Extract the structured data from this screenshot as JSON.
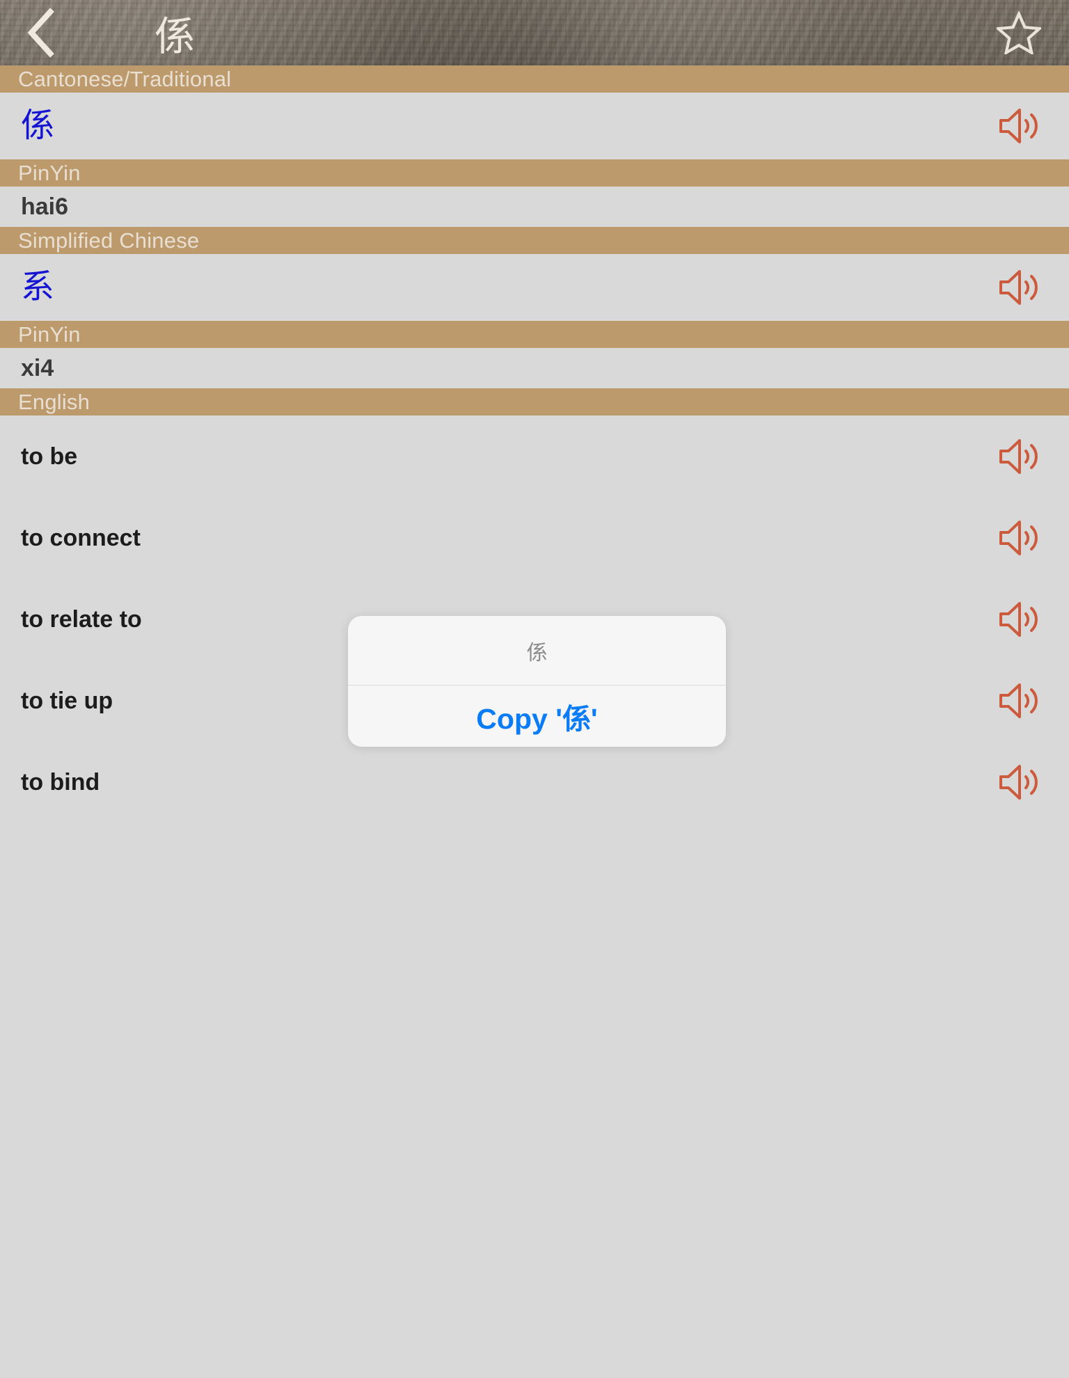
{
  "navbar": {
    "back_icon": "chevron-left-icon",
    "title": "係",
    "favorite_icon": "star-outline-icon"
  },
  "sections": [
    {
      "header": "Cantonese/Traditional",
      "type": "cjk",
      "rows": [
        {
          "text": "係",
          "has_audio": true,
          "audio_icon": "speaker-icon"
        }
      ]
    },
    {
      "header": "PinYin",
      "type": "pinyin",
      "rows": [
        {
          "text": "hai6",
          "has_audio": false
        }
      ]
    },
    {
      "header": "Simplified Chinese",
      "type": "cjk",
      "rows": [
        {
          "text": "系",
          "has_audio": true,
          "audio_icon": "speaker-icon"
        }
      ]
    },
    {
      "header": "PinYin",
      "type": "pinyin",
      "rows": [
        {
          "text": "xi4",
          "has_audio": false
        }
      ]
    },
    {
      "header": "English",
      "type": "english",
      "rows": [
        {
          "text": "to be",
          "has_audio": true,
          "audio_icon": "speaker-icon"
        },
        {
          "text": "to connect",
          "has_audio": true,
          "audio_icon": "speaker-icon"
        },
        {
          "text": "to relate to",
          "has_audio": true,
          "audio_icon": "speaker-icon"
        },
        {
          "text": "to tie up",
          "has_audio": true,
          "audio_icon": "speaker-icon"
        },
        {
          "text": "to bind",
          "has_audio": true,
          "audio_icon": "speaker-icon"
        }
      ]
    }
  ],
  "copy_dialog": {
    "title": "係",
    "action_label": "Copy '係'"
  },
  "colors": {
    "section_header_bg": "#bc9a6c",
    "section_header_text": "#e8ded2",
    "row_bg": "#d9d9d9",
    "cjk_text": "#1414d2",
    "speaker_icon": "#cc5b3d",
    "dialog_action": "#0a7cf5",
    "navbar_text": "#efe9e0"
  }
}
